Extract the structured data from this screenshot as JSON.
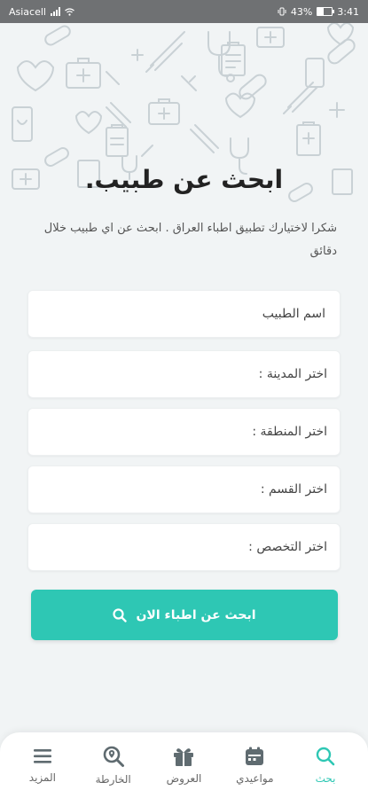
{
  "status_bar": {
    "carrier": "Asiacell",
    "battery": "43%",
    "time": "3:41"
  },
  "page": {
    "title": "ابحث عن طبيب.",
    "subtitle": "شكرا لاختيارك تطبيق اطباء العراق . ابحث عن اي طبيب خلال دقائق"
  },
  "form": {
    "doctor_name_placeholder": "اسم الطبيب",
    "city_label": "اختر المدينة :",
    "area_label": "اختر المنطقة :",
    "department_label": "اختر القسم :",
    "specialty_label": "اختر التخصص :",
    "search_button": "ابحث عن اطباء الان"
  },
  "nav": [
    {
      "label": "بحث",
      "icon": "search-icon",
      "active": true
    },
    {
      "label": "مواعيدي",
      "icon": "calendar-icon",
      "active": false
    },
    {
      "label": "العروض",
      "icon": "gift-icon",
      "active": false
    },
    {
      "label": "الخارطة",
      "icon": "map-search-icon",
      "active": false
    },
    {
      "label": "المزيد",
      "icon": "menu-icon",
      "active": false
    }
  ],
  "colors": {
    "accent": "#2ec7b4",
    "background": "#f1f4f5",
    "status_bar": "#6f7173"
  }
}
